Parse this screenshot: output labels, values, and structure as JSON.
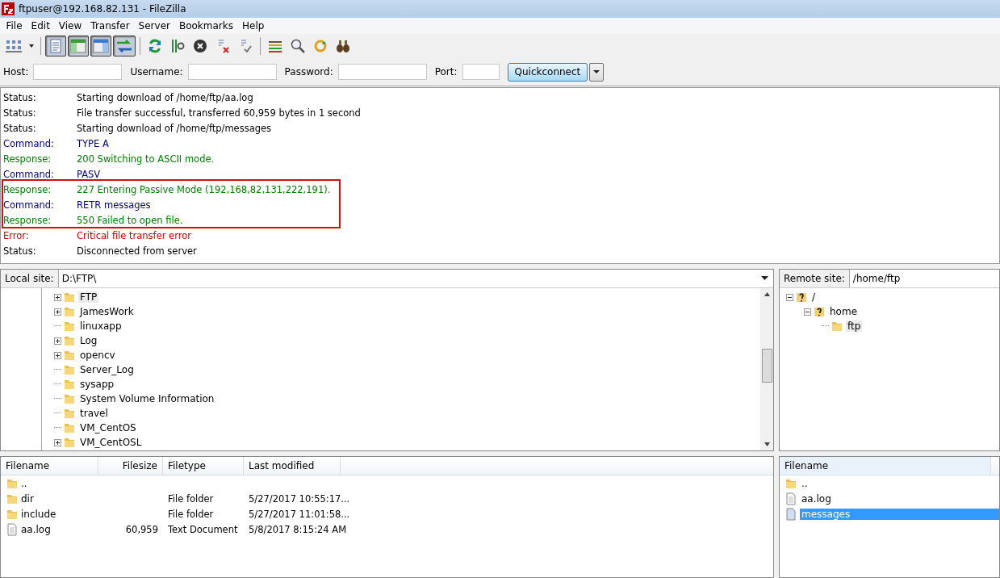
{
  "window": {
    "title": "ftpuser@192.168.82.131 - FileZilla"
  },
  "menu": [
    "File",
    "Edit",
    "View",
    "Transfer",
    "Server",
    "Bookmarks",
    "Help"
  ],
  "toolbar": [
    {
      "kind": "sitemanager",
      "pressed": false
    },
    {
      "kind": "dropdown",
      "pressed": false
    },
    {
      "kind": "sep"
    },
    {
      "kind": "log",
      "pressed": true
    },
    {
      "kind": "localtree",
      "pressed": true
    },
    {
      "kind": "remotetree",
      "pressed": true
    },
    {
      "kind": "queue",
      "pressed": true
    },
    {
      "kind": "sep"
    },
    {
      "kind": "refresh",
      "pressed": false
    },
    {
      "kind": "filter",
      "pressed": false
    },
    {
      "kind": "cancel",
      "pressed": false
    },
    {
      "kind": "disconnect",
      "pressed": false
    },
    {
      "kind": "reconnect",
      "pressed": false
    },
    {
      "kind": "sep"
    },
    {
      "kind": "compare",
      "pressed": false
    },
    {
      "kind": "search",
      "pressed": false
    },
    {
      "kind": "sync",
      "pressed": false
    },
    {
      "kind": "find",
      "pressed": false
    }
  ],
  "quickconnect": {
    "host_label": "Host:",
    "username_label": "Username:",
    "password_label": "Password:",
    "port_label": "Port:",
    "button": "Quickconnect"
  },
  "log": [
    {
      "kind": "status",
      "label": "Status:",
      "text": "Starting download of /home/ftp/aa.log"
    },
    {
      "kind": "status",
      "label": "Status:",
      "text": "File transfer successful, transferred 60,959 bytes in 1 second"
    },
    {
      "kind": "status",
      "label": "Status:",
      "text": "Starting download of /home/ftp/messages"
    },
    {
      "kind": "command",
      "label": "Command:",
      "text": "TYPE A"
    },
    {
      "kind": "response",
      "label": "Response:",
      "text": "200 Switching to ASCII mode."
    },
    {
      "kind": "command",
      "label": "Command:",
      "text": "PASV"
    },
    {
      "kind": "response",
      "label": "Response:",
      "text": "227 Entering Passive Mode (192,168,82,131,222,191)."
    },
    {
      "kind": "command",
      "label": "Command:",
      "text": "RETR messages"
    },
    {
      "kind": "response",
      "label": "Response:",
      "text": "550 Failed to open file."
    },
    {
      "kind": "error",
      "label": "Error:",
      "text": "Critical file transfer error"
    },
    {
      "kind": "status",
      "label": "Status:",
      "text": "Disconnected from server"
    }
  ],
  "local_site": {
    "label": "Local site:",
    "path": "D:\\FTP\\",
    "tree": [
      {
        "name": "FTP",
        "expandable": true,
        "selected": true
      },
      {
        "name": "JamesWork",
        "expandable": true,
        "selected": false
      },
      {
        "name": "linuxapp",
        "expandable": false,
        "selected": false
      },
      {
        "name": "Log",
        "expandable": true,
        "selected": false
      },
      {
        "name": "opencv",
        "expandable": true,
        "selected": false
      },
      {
        "name": "Server_Log",
        "expandable": false,
        "selected": false
      },
      {
        "name": "sysapp",
        "expandable": false,
        "selected": false
      },
      {
        "name": "System Volume Information",
        "expandable": false,
        "selected": false
      },
      {
        "name": "travel",
        "expandable": false,
        "selected": false
      },
      {
        "name": "VM_CentOS",
        "expandable": false,
        "selected": false
      },
      {
        "name": "VM_CentOSL",
        "expandable": true,
        "selected": false
      }
    ]
  },
  "remote_site": {
    "label": "Remote site:",
    "path": "/home/ftp",
    "tree": [
      {
        "name": "/",
        "kind": "unknown",
        "expanded": true,
        "selected": false,
        "children": [
          {
            "name": "home",
            "kind": "unknown",
            "expanded": true,
            "selected": false,
            "children": [
              {
                "name": "ftp",
                "kind": "folder",
                "selected": true
              }
            ]
          }
        ]
      }
    ]
  },
  "local_files": {
    "columns": [
      "Filename",
      "Filesize",
      "Filetype",
      "Last modified"
    ],
    "rows": [
      {
        "kind": "folder",
        "name": "..",
        "selected": false
      },
      {
        "kind": "folder",
        "name": "dir",
        "type": "File folder",
        "modified": "5/27/2017 10:55:17...",
        "selected": false
      },
      {
        "kind": "folder",
        "name": "include",
        "type": "File folder",
        "modified": "5/27/2017 11:01:58...",
        "selected": false
      },
      {
        "kind": "file",
        "name": "aa.log",
        "size": "60,959",
        "type": "Text Document",
        "modified": "5/8/2017 8:15:24 AM",
        "selected": false
      }
    ]
  },
  "remote_files": {
    "columns": [
      "Filename"
    ],
    "rows": [
      {
        "kind": "folder",
        "name": "..",
        "selected": false
      },
      {
        "kind": "file",
        "name": "aa.log",
        "selected": false
      },
      {
        "kind": "file",
        "name": "messages",
        "selected": true
      }
    ]
  }
}
